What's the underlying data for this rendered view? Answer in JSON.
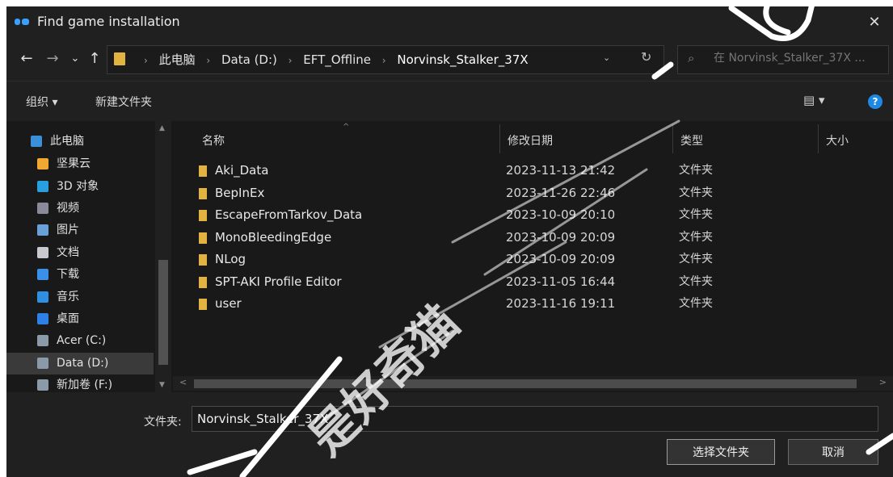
{
  "window": {
    "title": "Find game installation",
    "close_glyph": "✕",
    "accent": "#1e88e5"
  },
  "nav": {
    "back": "←",
    "forward": "→",
    "recent": "⌄",
    "up": "↑",
    "breadcrumbs": [
      "此电脑",
      "Data (D:)",
      "EFT_Offline",
      "Norvinsk_Stalker_37X"
    ],
    "sep": "›",
    "dropdown": "⌄",
    "refresh": "↻",
    "search_placeholder": "在 Norvinsk_Stalker_37X ...",
    "search_icon": "⌕"
  },
  "toolbar": {
    "organize": "组织 ▾",
    "new_folder": "新建文件夹",
    "view": "▤ ▾",
    "help": "?"
  },
  "sidebar": {
    "items": [
      {
        "label": "此电脑",
        "icon": "pc-icon",
        "color": "#3a8fd8"
      },
      {
        "label": "坚果云",
        "icon": "nutstore-icon",
        "color": "#f0a830"
      },
      {
        "label": "3D 对象",
        "icon": "3d-objects-icon",
        "color": "#28a0e0"
      },
      {
        "label": "视频",
        "icon": "video-icon",
        "color": "#8a8a9a"
      },
      {
        "label": "图片",
        "icon": "pictures-icon",
        "color": "#6aa0d8"
      },
      {
        "label": "文档",
        "icon": "documents-icon",
        "color": "#c8c8d0"
      },
      {
        "label": "下载",
        "icon": "downloads-icon",
        "color": "#3a8fe8"
      },
      {
        "label": "音乐",
        "icon": "music-icon",
        "color": "#2f8fe0"
      },
      {
        "label": "桌面",
        "icon": "desktop-icon",
        "color": "#2f7fe8"
      },
      {
        "label": "Acer (C:)",
        "icon": "drive-c-icon",
        "color": "#8a9aa8"
      },
      {
        "label": "Data (D:)",
        "icon": "drive-d-icon",
        "color": "#8a9aa8"
      },
      {
        "label": "新加卷 (F:)",
        "icon": "drive-f-icon",
        "color": "#8a9aa8"
      }
    ],
    "selected_index": 10,
    "scroll_up": "▲",
    "scroll_down": "▼"
  },
  "columns": {
    "name": "名称",
    "date": "修改日期",
    "type": "类型",
    "size": "大小",
    "sort_indicator": "^"
  },
  "files": [
    {
      "name": "Aki_Data",
      "date": "2023-11-13 21:42",
      "type": "文件夹"
    },
    {
      "name": "BepInEx",
      "date": "2023-11-26 22:46",
      "type": "文件夹"
    },
    {
      "name": "EscapeFromTarkov_Data",
      "date": "2023-10-09 20:10",
      "type": "文件夹"
    },
    {
      "name": "MonoBleedingEdge",
      "date": "2023-10-09 20:09",
      "type": "文件夹"
    },
    {
      "name": "NLog",
      "date": "2023-10-09 20:09",
      "type": "文件夹"
    },
    {
      "name": "SPT-AKI Profile Editor",
      "date": "2023-11-05 16:44",
      "type": "文件夹"
    },
    {
      "name": "user",
      "date": "2023-11-16 19:11",
      "type": "文件夹"
    }
  ],
  "hscroll": {
    "left": "<",
    "right": ">"
  },
  "bottom": {
    "folder_label": "文件夹:",
    "folder_value": "Norvinsk_Stalker_37X",
    "select_button": "选择文件夹",
    "cancel_button": "取消"
  },
  "watermark": {
    "text": "是好奇猫"
  }
}
